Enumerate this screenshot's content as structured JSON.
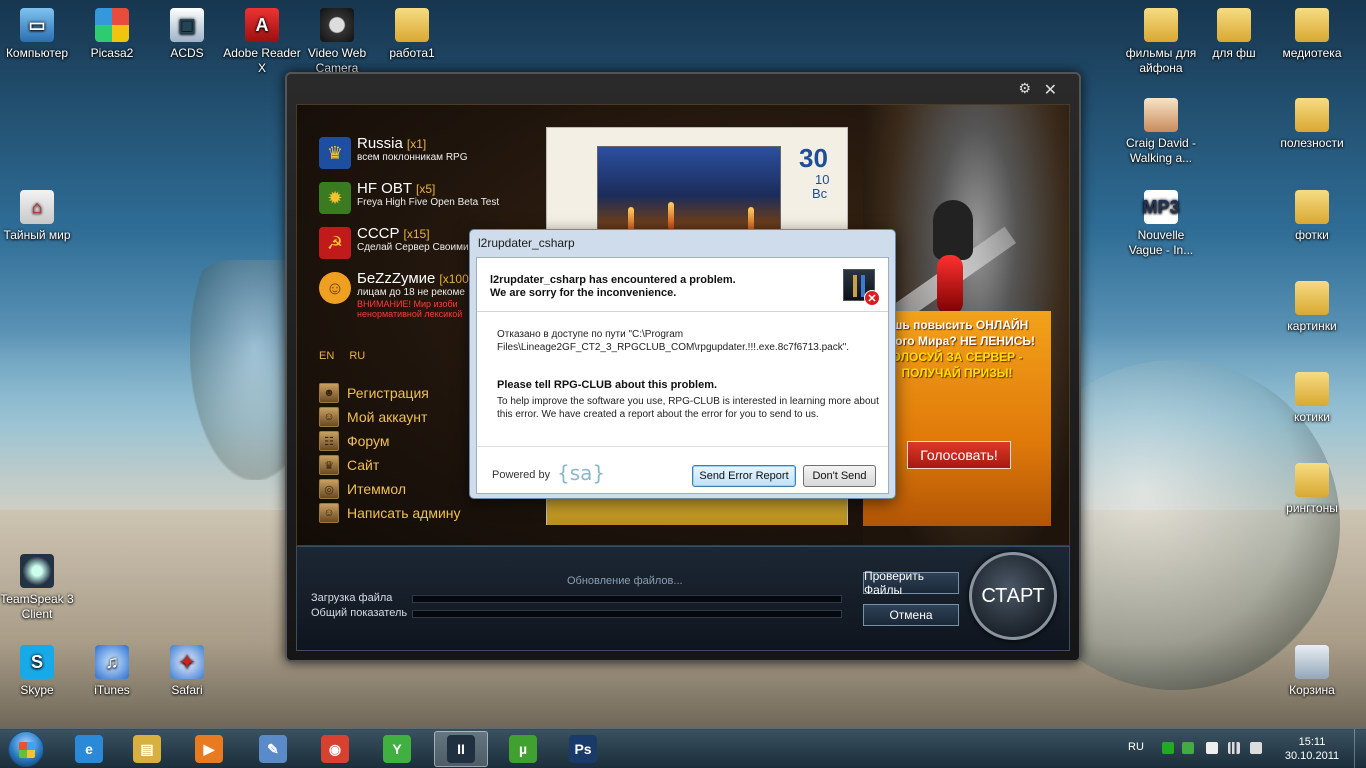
{
  "desktop": {
    "icons_left": [
      {
        "label": "Компьютер",
        "icon": "computer-icon"
      },
      {
        "label": "Picasa2",
        "icon": "picasa-icon"
      },
      {
        "label": "ACDS",
        "icon": "acdsee-icon"
      },
      {
        "label": "Adobe Reader X",
        "icon": "adobe-reader-icon"
      },
      {
        "label": "Video Web Camera",
        "icon": "webcam-icon"
      },
      {
        "label": "работа1",
        "icon": "folder-icon"
      },
      {
        "label": "Тайный мир",
        "icon": "pagoda-icon"
      },
      {
        "label": "TeamSpeak 3 Client",
        "icon": "teamspeak-icon"
      },
      {
        "label": "Skype",
        "icon": "skype-icon"
      },
      {
        "label": "iTunes",
        "icon": "itunes-icon"
      },
      {
        "label": "Safari",
        "icon": "safari-icon"
      }
    ],
    "icons_right": [
      {
        "label": "фильмы для айфона",
        "icon": "folder-icon"
      },
      {
        "label": "для фш",
        "icon": "folder-icon"
      },
      {
        "label": "медиотека",
        "icon": "folder-icon"
      },
      {
        "label": "Craig David - Walking a...",
        "icon": "album-art-icon"
      },
      {
        "label": "полезности",
        "icon": "folder-icon"
      },
      {
        "label": "Nouvelle Vague - In...",
        "icon": "mp3-file-icon"
      },
      {
        "label": "фотки",
        "icon": "folder-icon"
      },
      {
        "label": "картинки",
        "icon": "folder-icon"
      },
      {
        "label": "котики",
        "icon": "folder-icon"
      },
      {
        "label": "рингтоны",
        "icon": "folder-icon"
      },
      {
        "label": "Корзина",
        "icon": "recycle-bin-icon"
      }
    ]
  },
  "launcher": {
    "servers": [
      {
        "name": "Russia",
        "rate": "[x1]",
        "desc": "всем поклонникам RPG",
        "icon": "russia-emblem-icon"
      },
      {
        "name": "HF OBT",
        "rate": "[x5]",
        "desc": "Freya High Five Open Beta Test",
        "icon": "gear-icon"
      },
      {
        "name": "СССР",
        "rate": "[x15]",
        "desc": "Сделай Сервер Своими",
        "icon": "hammer-sickle-icon"
      },
      {
        "name": "БеZzZумие",
        "rate": "[x100",
        "desc": "лицам до 18 не рекоме",
        "warn1": "ВНИМАНИЕ! Мир изоби",
        "warn2": "ненормативной лексикой",
        "icon": "smiley-icon"
      }
    ],
    "languages": [
      "EN",
      "RU"
    ],
    "menu": [
      {
        "label": "Регистрация",
        "icon": "register-icon"
      },
      {
        "label": "Мой аккаунт",
        "icon": "account-icon"
      },
      {
        "label": "Форум",
        "icon": "forum-icon"
      },
      {
        "label": "Сайт",
        "icon": "site-icon"
      },
      {
        "label": "Итеммол",
        "icon": "coins-icon"
      },
      {
        "label": "Написать админу",
        "icon": "admin-icon"
      }
    ],
    "news": {
      "day": "30",
      "month": "10",
      "weekday": "Вс"
    },
    "vote": {
      "line1": "ешь повысить ОНЛАЙН",
      "line2": "много Мира?  НЕ ЛЕНИСЬ!",
      "line3": "ОЛОСУЙ ЗА СЕРВЕР -",
      "line4": "ПОЛУЧАЙ ПРИЗЫ!",
      "button": "Голосовать!"
    },
    "status": "Обновление файлов...",
    "progress": {
      "file_label": "Загрузка файла",
      "total_label": "Общий показатель",
      "file_value": 0,
      "total_value": 0
    },
    "buttons": {
      "check": "Проверить Файлы",
      "cancel": "Отмена",
      "start": "СТАРТ"
    }
  },
  "dialog": {
    "title": "l2rupdater_csharp",
    "heading1": "l2rupdater_csharp has encountered a problem.",
    "heading2": "We are sorry for the inconvenience.",
    "message": "Отказано в доступе по пути \"C:\\Program Files\\Lineage2GF_CT2_3_RPGCLUB_COM\\rpgupdater.!!!.exe.8c7f6713.pack\".",
    "tell_heading": "Please tell RPG-CLUB about this problem.",
    "tell_text": "To help improve the software you use, RPG-CLUB is interested in learning more about this error. We have created a report about the error for you to send to us.",
    "powered_by": "Powered by",
    "logo": "{sa}",
    "send_button": "Send Error Report",
    "dont_send_button": "Don't Send"
  },
  "taskbar": {
    "items": [
      {
        "name": "internet-explorer",
        "icon": "ie-icon",
        "color": "#2a8ad8",
        "glyph": "e"
      },
      {
        "name": "explorer",
        "icon": "folder-icon",
        "color": "#d8b040",
        "glyph": "▤"
      },
      {
        "name": "media-player",
        "icon": "media-player-icon",
        "color": "#e87a20",
        "glyph": "▶"
      },
      {
        "name": "paint-tool",
        "icon": "brush-icon",
        "color": "#5a8ac8",
        "glyph": "✎"
      },
      {
        "name": "chrome",
        "icon": "chrome-icon",
        "color": "#d84030",
        "glyph": "◉"
      },
      {
        "name": "drink-app",
        "icon": "cup-icon",
        "color": "#40b040",
        "glyph": "Y"
      },
      {
        "name": "lineage-launcher",
        "icon": "lineage-icon",
        "color": "#203040",
        "glyph": "II"
      },
      {
        "name": "utorrent",
        "icon": "utorrent-icon",
        "color": "#40a030",
        "glyph": "µ"
      },
      {
        "name": "photoshop",
        "icon": "photoshop-icon",
        "color": "#1a3a6a",
        "glyph": "Ps"
      }
    ],
    "active_index": 6,
    "language": "RU",
    "time": "15:11",
    "date": "30.10.2011"
  }
}
